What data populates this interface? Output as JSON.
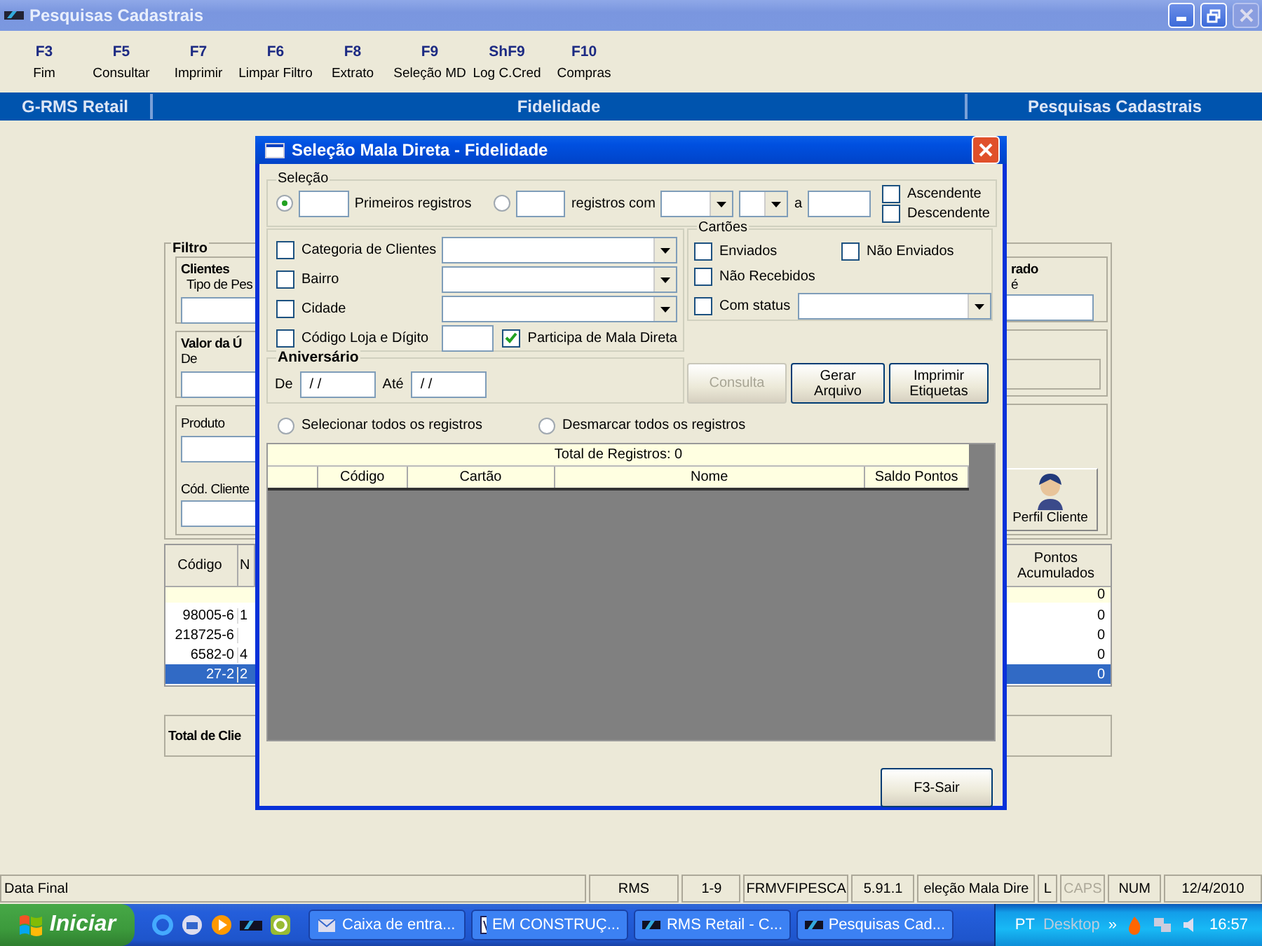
{
  "window": {
    "title": "Pesquisas Cadastrais"
  },
  "toolbar": [
    {
      "key": "F3",
      "label": "Fim"
    },
    {
      "key": "F5",
      "label": "Consultar"
    },
    {
      "key": "F7",
      "label": "Imprimir"
    },
    {
      "key": "F6",
      "label": "Limpar Filtro"
    },
    {
      "key": "F8",
      "label": "Extrato"
    },
    {
      "key": "F9",
      "label": "Seleção MD"
    },
    {
      "key": "ShF9",
      "label": "Log C.Cred"
    },
    {
      "key": "F10",
      "label": "Compras"
    }
  ],
  "header": {
    "left": "G-RMS Retail",
    "center": "Fidelidade",
    "right": "Pesquisas Cadastrais"
  },
  "filter": {
    "title": "Filtro",
    "clients_title": "Clientes",
    "type_label": "Tipo de Pes",
    "value_title": "Valor da Ú",
    "from_label": "De",
    "product_label": "Produto",
    "client_code_label": "Cód. Cliente",
    "right_group_title": "rado",
    "right_field_label": "é",
    "profile_button": "Perfil Cliente"
  },
  "table": {
    "columns": [
      "Código",
      "N",
      "Pontos Acumulados"
    ],
    "summary_points": "0",
    "rows": [
      {
        "code": "98005-6",
        "column_2": "1",
        "points": "0",
        "selected": false
      },
      {
        "code": "218725-6",
        "column_2": "",
        "points": "0",
        "selected": false
      },
      {
        "code": "6582-0",
        "column_2": "4",
        "points": "0",
        "selected": false
      },
      {
        "code": "27-2",
        "column_2": "2",
        "points": "0",
        "selected": true
      }
    ]
  },
  "total_label": "Total de Clie",
  "dialog": {
    "title": "Seleção Mala Direta - Fidelidade",
    "selection": {
      "title": "Seleção",
      "first_radio": {
        "label": "Primeiros registros",
        "selected": true
      },
      "with_radio": {
        "label": "registros com",
        "selected": false
      },
      "range_to": "a",
      "order": [
        {
          "label": "Ascendente",
          "checked": false
        },
        {
          "label": "Descendente",
          "checked": false
        }
      ]
    },
    "filters": [
      {
        "kind": "combo",
        "label": "Categoria de Clientes",
        "checked": false
      },
      {
        "kind": "combo",
        "label": "Bairro",
        "checked": false
      },
      {
        "kind": "combo",
        "label": "Cidade",
        "checked": false
      },
      {
        "kind": "text",
        "label": "Código Loja e Dígito",
        "checked": false
      }
    ],
    "mailing": {
      "label": "Participa de Mala Direta",
      "checked": true
    },
    "cards": {
      "title": "Cartões",
      "options": [
        {
          "label": "Enviados",
          "checked": false
        },
        {
          "label": "Não Enviados",
          "checked": false
        },
        {
          "label": "Não Recebidos",
          "checked": false
        },
        {
          "label": "Com status",
          "checked": false
        }
      ]
    },
    "birthday": {
      "title": "Aniversário",
      "from_label": "De",
      "from_value": "/ /",
      "to_label": "Até",
      "to_value": "/ /"
    },
    "buttons": [
      {
        "label": "Consulta",
        "disabled": true
      },
      {
        "label": "Gerar Arquivo",
        "disabled": false
      },
      {
        "label": "Imprimir Etiquetas",
        "disabled": false
      }
    ],
    "select_radios": [
      {
        "label": "Selecionar todos os registros",
        "selected": false
      },
      {
        "label": "Desmarcar todos os registros",
        "selected": false
      }
    ],
    "grid": {
      "title": "Total de Registros: 0",
      "columns": [
        "Código",
        "Cartão",
        "Nome",
        "Saldo Pontos"
      ]
    },
    "exit_button": "F3-Sair"
  },
  "status_bar": [
    {
      "text": "Data Final",
      "disabled": false
    },
    {
      "text": "RMS",
      "disabled": false
    },
    {
      "text": "1-9",
      "disabled": false
    },
    {
      "text": "FRMVFIPESCA",
      "disabled": false
    },
    {
      "text": "5.91.1",
      "disabled": false
    },
    {
      "text": "eleção Mala Dire",
      "disabled": false
    },
    {
      "text": "L",
      "disabled": false
    },
    {
      "text": "CAPS",
      "disabled": true
    },
    {
      "text": "NUM",
      "disabled": false
    },
    {
      "text": "12/4/2010",
      "disabled": false
    }
  ],
  "taskbar": {
    "start": "Iniciar",
    "tasks": [
      "Caixa de entra...",
      "EM CONSTRUÇ...",
      "RMS Retail - C...",
      "Pesquisas Cad..."
    ],
    "language": "PT",
    "desktop": "Desktop",
    "chevron": "»",
    "clock": "16:57"
  }
}
